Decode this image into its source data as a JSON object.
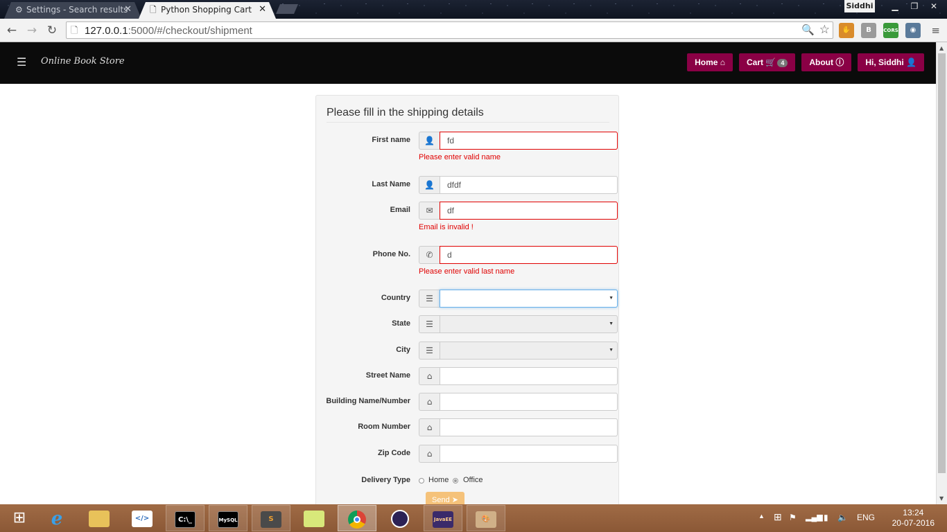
{
  "browser": {
    "tabs": [
      {
        "title": "Settings - Search results",
        "icon": "gear-icon",
        "active": false
      },
      {
        "title": "Python Shopping Cart",
        "icon": "page-icon",
        "active": true
      }
    ],
    "profile_name": "Siddhi",
    "url_host": "127.0.0.1",
    "url_path": ":5000/#/checkout/shipment",
    "extensions": [
      {
        "name": "hand-extension-icon",
        "color": "#d98b2b"
      },
      {
        "name": "b-extension-icon",
        "label": "B",
        "color": "#9a9a9a"
      },
      {
        "name": "cors-extension-icon",
        "label": "CORS",
        "color": "#3a9a3a"
      },
      {
        "name": "eye-extension-icon",
        "color": "#5a7a9a"
      }
    ]
  },
  "navbar": {
    "brand": "Online Book Store",
    "links": [
      {
        "label": "Home",
        "icon": "home-icon"
      },
      {
        "label": "Cart",
        "icon": "cart-icon",
        "badge": "4"
      },
      {
        "label": "About",
        "icon": "info-icon"
      },
      {
        "label": "Hi, Siddhi",
        "icon": "user-icon"
      }
    ]
  },
  "form": {
    "title": "Please fill in the shipping details",
    "fields": {
      "first_name": {
        "label": "First name",
        "value": "fd",
        "error": "Please enter valid name",
        "icon": "user-icon"
      },
      "last_name": {
        "label": "Last Name",
        "value": "dfdf",
        "icon": "user-icon"
      },
      "email": {
        "label": "Email",
        "value": "df",
        "error": "Email is invalid !",
        "icon": "envelope-icon"
      },
      "phone": {
        "label": "Phone No.",
        "value": "d",
        "error": "Please enter valid last name",
        "icon": "phone-icon"
      },
      "country": {
        "label": "Country",
        "value": "",
        "icon": "list-icon"
      },
      "state": {
        "label": "State",
        "value": "",
        "icon": "list-icon"
      },
      "city": {
        "label": "City",
        "value": "",
        "icon": "list-icon"
      },
      "street": {
        "label": "Street Name",
        "value": "",
        "icon": "home-icon"
      },
      "building": {
        "label": "Building Name/Number",
        "value": "",
        "icon": "home-icon"
      },
      "room": {
        "label": "Room Number",
        "value": "",
        "icon": "home-icon"
      },
      "zip": {
        "label": "Zip Code",
        "value": "",
        "icon": "home-icon"
      }
    },
    "delivery": {
      "label": "Delivery Type",
      "options": [
        "Home",
        "Office"
      ],
      "selected": "Office"
    },
    "submit_label": "Send"
  },
  "taskbar": {
    "apps": [
      "Start",
      "Internet Explorer",
      "File Explorer",
      "Visual Studio",
      "Command Prompt",
      "MySQL",
      "Sublime Text",
      "Sticky Notes",
      "Chrome",
      "Eclipse",
      "Java EE IDE",
      "Paint"
    ],
    "language": "ENG",
    "time": "13:24",
    "date": "20-07-2016"
  },
  "colors": {
    "nav_button": "#8a0045",
    "error": "#e00000",
    "send_button": "#f5c27a",
    "taskbar": "#9b6540"
  }
}
